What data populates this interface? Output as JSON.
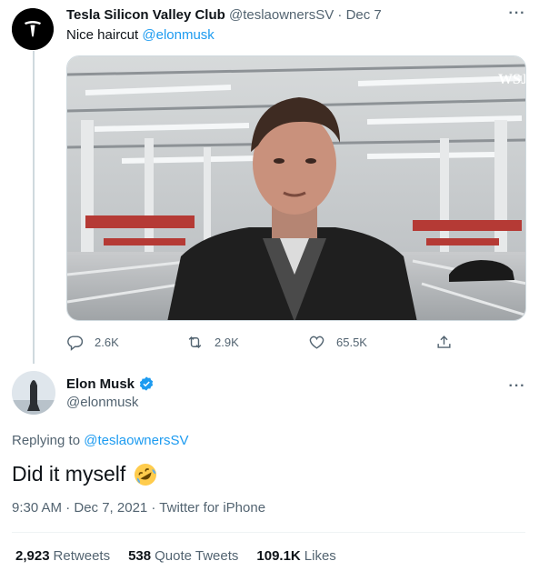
{
  "parent_tweet": {
    "author_name": "Tesla Silicon Valley Club",
    "author_handle": "@teslaownersSV",
    "separator": "·",
    "date": "Dec 7",
    "text": "Nice haircut ",
    "mention": "@elonmusk",
    "media_watermark": "WSJ",
    "counts": {
      "replies": "2.6K",
      "retweets": "2.9K",
      "likes": "65.5K"
    }
  },
  "main_tweet": {
    "author_name": "Elon Musk",
    "author_handle": "@elonmusk",
    "verified": true,
    "replying_label": "Replying to ",
    "replying_to": "@teslaownersSV",
    "text": "Did it myself",
    "emoji": "rolling-on-the-floor-laughing",
    "time": "9:30 AM · Dec 7, 2021 · Twitter for iPhone",
    "stats": [
      {
        "value": "2,923",
        "label": "Retweets"
      },
      {
        "value": "538",
        "label": "Quote Tweets"
      },
      {
        "value": "109.1K",
        "label": "Likes"
      }
    ]
  },
  "colors": {
    "accent": "#1d9bf0",
    "text": "#0f1419",
    "muted": "#536471"
  }
}
